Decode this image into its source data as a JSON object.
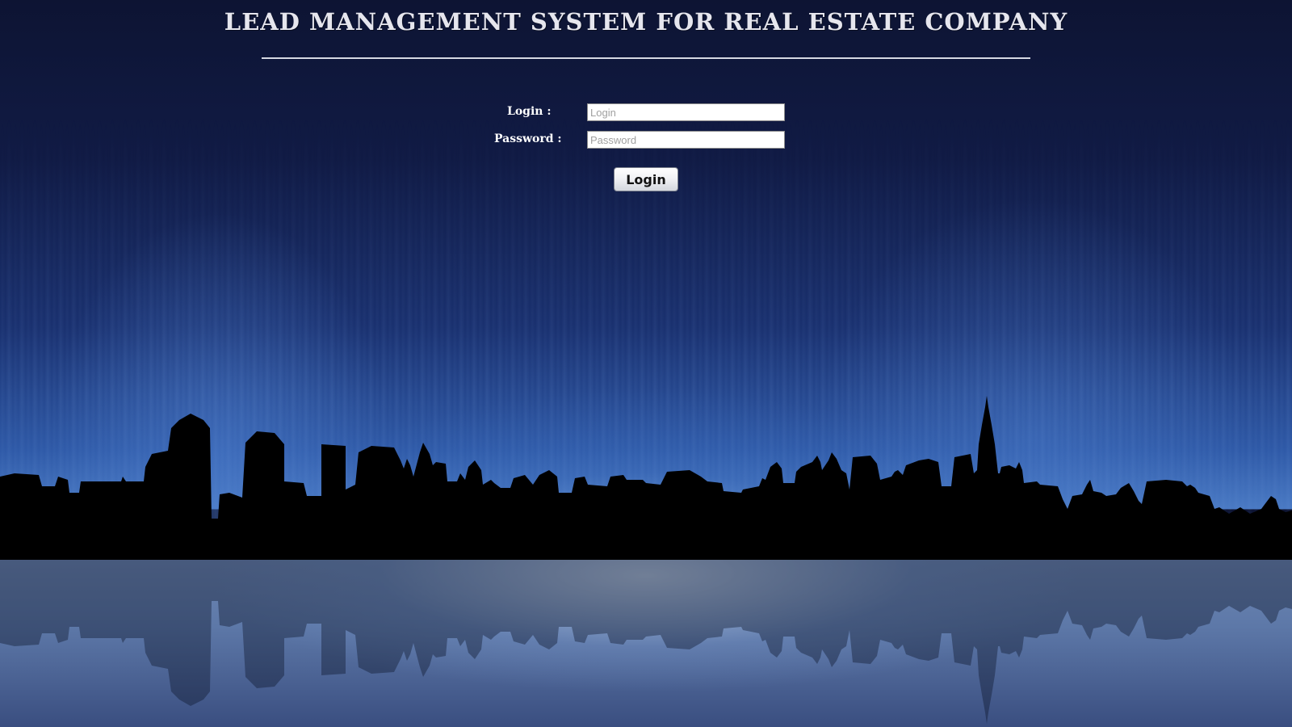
{
  "header": {
    "title": "LEAD MANAGEMENT SYSTEM FOR REAL ESTATE COMPANY"
  },
  "login_form": {
    "login_label": "Login :",
    "login_placeholder": "Login",
    "login_value": "",
    "password_label": "Password :",
    "password_placeholder": "Password",
    "password_value": "",
    "submit_label": "Login"
  },
  "colors": {
    "background": "#0d1434",
    "text": "#ffffff",
    "skyline": "#000000"
  }
}
